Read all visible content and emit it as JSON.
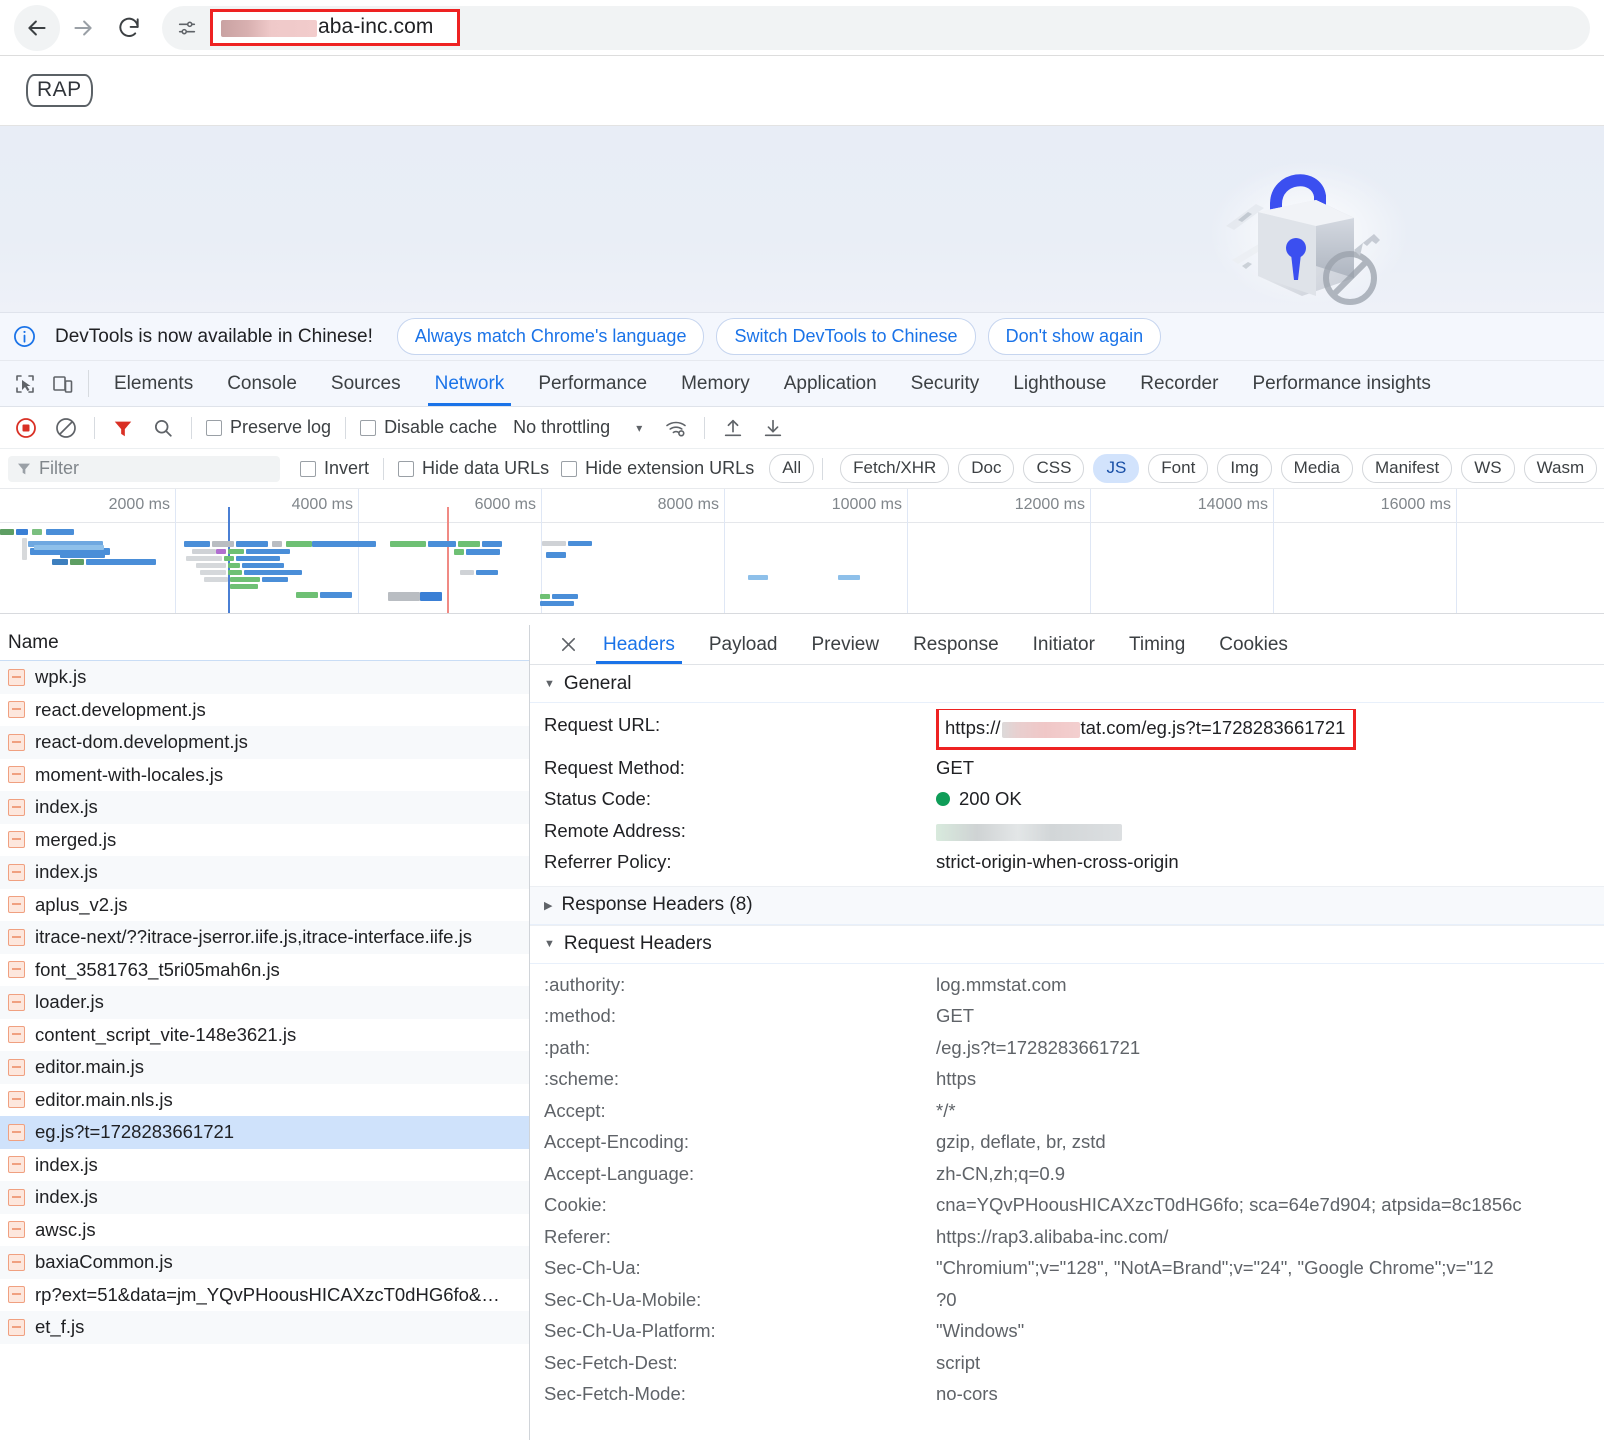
{
  "browser": {
    "back_icon": "arrow-left-icon",
    "forward_icon": "arrow-right-icon",
    "reload_icon": "reload-icon",
    "tune_icon": "tune-icon",
    "url_text": "aba-inc.com",
    "url_redacted": true,
    "highlight_color": "#ee2222"
  },
  "page": {
    "logo_text": "RAP",
    "hero_illustration": "lock-illustration"
  },
  "devtools": {
    "banner": {
      "icon": "info-icon",
      "message": "DevTools is now available in Chinese!",
      "buttons": [
        "Always match Chrome's language",
        "Switch DevTools to Chinese",
        "Don't show again"
      ]
    },
    "tool_icons": [
      "inspect-element-icon",
      "device-toolbar-icon"
    ],
    "tabs": [
      {
        "label": "Elements",
        "active": false
      },
      {
        "label": "Console",
        "active": false
      },
      {
        "label": "Sources",
        "active": false
      },
      {
        "label": "Network",
        "active": true
      },
      {
        "label": "Performance",
        "active": false
      },
      {
        "label": "Memory",
        "active": false
      },
      {
        "label": "Application",
        "active": false
      },
      {
        "label": "Security",
        "active": false
      },
      {
        "label": "Lighthouse",
        "active": false
      },
      {
        "label": "Recorder",
        "active": false
      },
      {
        "label": "Performance insights",
        "active": false
      }
    ],
    "toolbar": {
      "record_icon": "record-stop-icon",
      "clear_icon": "clear-icon",
      "filter_icon": "filter-icon",
      "search_icon": "search-icon",
      "preserve_log_label": "Preserve log",
      "preserve_log_checked": false,
      "disable_cache_label": "Disable cache",
      "disable_cache_checked": false,
      "throttling_value": "No throttling",
      "dropdown_icon": "chevron-down-icon",
      "wifi_icon": "network-conditions-icon",
      "import_icon": "import-har-icon",
      "export_icon": "export-har-icon"
    },
    "filter_row": {
      "filter_icon": "filter-funnel-icon",
      "filter_placeholder": "Filter",
      "invert_label": "Invert",
      "invert_checked": false,
      "hide_data_urls_label": "Hide data URLs",
      "hide_data_urls_checked": false,
      "hide_extension_urls_label": "Hide extension URLs",
      "hide_extension_urls_checked": false,
      "type_chips": [
        {
          "label": "All",
          "selected": false
        },
        {
          "label": "Fetch/XHR",
          "selected": false
        },
        {
          "label": "Doc",
          "selected": false
        },
        {
          "label": "CSS",
          "selected": false
        },
        {
          "label": "JS",
          "selected": true
        },
        {
          "label": "Font",
          "selected": false
        },
        {
          "label": "Img",
          "selected": false
        },
        {
          "label": "Media",
          "selected": false
        },
        {
          "label": "Manifest",
          "selected": false
        },
        {
          "label": "WS",
          "selected": false
        },
        {
          "label": "Wasm",
          "selected": false
        }
      ]
    },
    "overview": {
      "tick_labels": [
        "2000 ms",
        "4000 ms",
        "6000 ms",
        "8000 ms",
        "10000 ms",
        "12000 ms",
        "14000 ms",
        "16000 ms"
      ],
      "dom_content_loaded_marker_color": "#4a7fd4",
      "load_marker_color": "#f08a84"
    },
    "requests": {
      "column_header": "Name",
      "rows": [
        {
          "name": "wpk.js",
          "selected": false
        },
        {
          "name": "react.development.js",
          "selected": false
        },
        {
          "name": "react-dom.development.js",
          "selected": false
        },
        {
          "name": "moment-with-locales.js",
          "selected": false
        },
        {
          "name": "index.js",
          "selected": false
        },
        {
          "name": "merged.js",
          "selected": false
        },
        {
          "name": "index.js",
          "selected": false
        },
        {
          "name": "aplus_v2.js",
          "selected": false
        },
        {
          "name": "itrace-next/??itrace-jserror.iife.js,itrace-interface.iife.js",
          "selected": false
        },
        {
          "name": "font_3581763_t5ri05mah6n.js",
          "selected": false
        },
        {
          "name": "loader.js",
          "selected": false
        },
        {
          "name": "content_script_vite-148e3621.js",
          "selected": false
        },
        {
          "name": "editor.main.js",
          "selected": false
        },
        {
          "name": "editor.main.nls.js",
          "selected": false
        },
        {
          "name": "eg.js?t=1728283661721",
          "selected": true
        },
        {
          "name": "index.js",
          "selected": false
        },
        {
          "name": "index.js",
          "selected": false
        },
        {
          "name": "awsc.js",
          "selected": false
        },
        {
          "name": "baxiaCommon.js",
          "selected": false
        },
        {
          "name": "rp?ext=51&data=jm_YQvPHoousHICAXzcT0dHG6fo&…",
          "selected": false
        },
        {
          "name": "et_f.js",
          "selected": false
        }
      ]
    },
    "details": {
      "close_icon": "close-icon",
      "tabs": [
        {
          "label": "Headers",
          "active": true
        },
        {
          "label": "Payload",
          "active": false
        },
        {
          "label": "Preview",
          "active": false
        },
        {
          "label": "Response",
          "active": false
        },
        {
          "label": "Initiator",
          "active": false
        },
        {
          "label": "Timing",
          "active": false
        },
        {
          "label": "Cookies",
          "active": false
        }
      ],
      "general": {
        "title": "General",
        "expanded": true,
        "rows": [
          {
            "key": "Request URL:",
            "value": "https://",
            "value_tail": "tat.com/eg.js?t=1728283661721",
            "redacted": true,
            "highlighted": true
          },
          {
            "key": "Request Method:",
            "value": "GET"
          },
          {
            "key": "Status Code:",
            "value": "200 OK",
            "status_dot": "#0f9d58"
          },
          {
            "key": "Remote Address:",
            "value": "",
            "redacted": true
          },
          {
            "key": "Referrer Policy:",
            "value": "strict-origin-when-cross-origin"
          }
        ]
      },
      "response_headers": {
        "title": "Response Headers (8)",
        "expanded": false
      },
      "request_headers": {
        "title": "Request Headers",
        "expanded": true,
        "rows": [
          {
            "key": ":authority:",
            "value": "log.mmstat.com"
          },
          {
            "key": ":method:",
            "value": "GET"
          },
          {
            "key": ":path:",
            "value": "/eg.js?t=1728283661721"
          },
          {
            "key": ":scheme:",
            "value": "https"
          },
          {
            "key": "Accept:",
            "value": "*/*"
          },
          {
            "key": "Accept-Encoding:",
            "value": "gzip, deflate, br, zstd"
          },
          {
            "key": "Accept-Language:",
            "value": "zh-CN,zh;q=0.9"
          },
          {
            "key": "Cookie:",
            "value": "cna=YQvPHoousHICAXzcT0dHG6fo; sca=64e7d904; atpsida=8c1856c"
          },
          {
            "key": "Referer:",
            "value": "https://rap3.alibaba-inc.com/"
          },
          {
            "key": "Sec-Ch-Ua:",
            "value": "\"Chromium\";v=\"128\", \"NotA=Brand\";v=\"24\", \"Google Chrome\";v=\"12"
          },
          {
            "key": "Sec-Ch-Ua-Mobile:",
            "value": "?0"
          },
          {
            "key": "Sec-Ch-Ua-Platform:",
            "value": "\"Windows\""
          },
          {
            "key": "Sec-Fetch-Dest:",
            "value": "script"
          },
          {
            "key": "Sec-Fetch-Mode:",
            "value": "no-cors"
          }
        ]
      }
    }
  }
}
